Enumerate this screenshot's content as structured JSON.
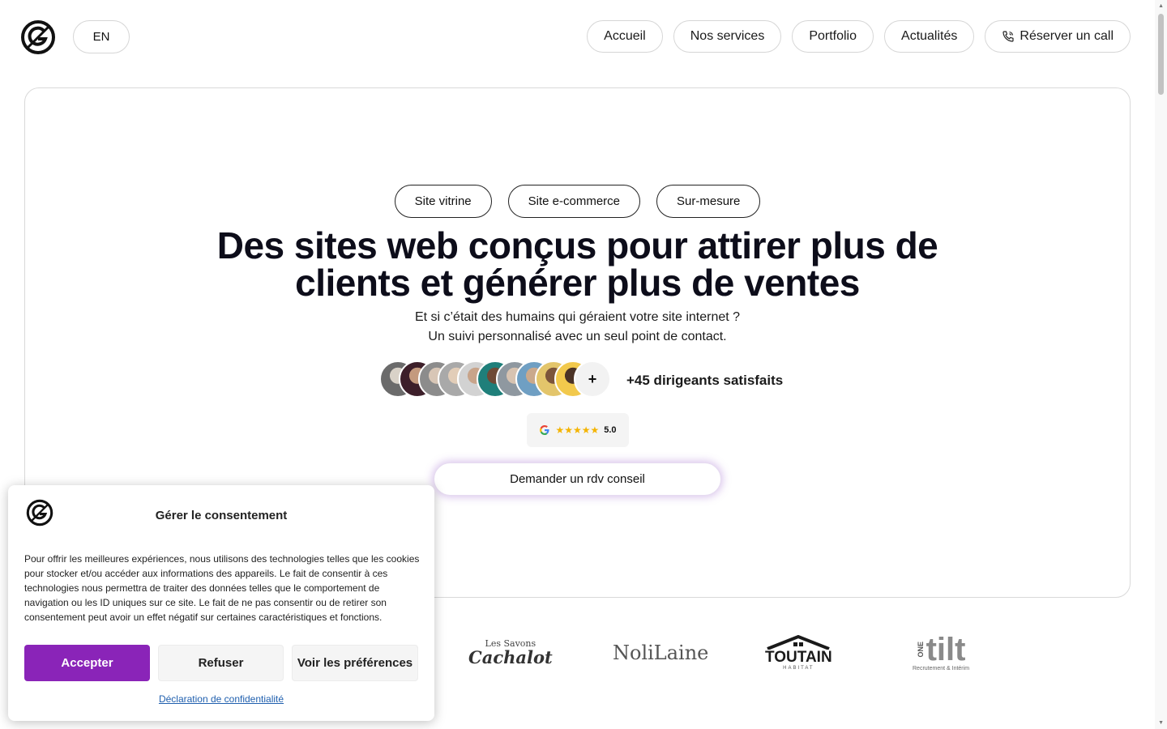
{
  "header": {
    "lang": "EN",
    "nav": [
      "Accueil",
      "Nos services",
      "Portfolio",
      "Actualités"
    ],
    "call_button": "Réserver un call"
  },
  "hero": {
    "tags": [
      "Site vitrine",
      "Site e-commerce",
      "Sur-mesure"
    ],
    "title_line1": "Des sites web conçus pour attirer plus de",
    "title_line2": "clients et générer plus de ventes",
    "subtitle_line1": "Et si c’était des humains qui géraient votre site internet ?",
    "subtitle_line2": "Un suivi personnalisé avec un seul point de contact.",
    "avatar_more": "+",
    "satisfied": "+45 dirigeants satisfaits",
    "rating_stars": "★★★★★",
    "rating_value": "5.0",
    "cta": "Demander un rdv conseil"
  },
  "clients": {
    "cachalot_small": "Les Savons",
    "cachalot_big": "Cachalot",
    "nolilaine": "NoliLaine",
    "toutain": "TOUTAIN",
    "toutain_small": "HABITAT",
    "onetilt_one": "ONE",
    "onetilt_tilt": "tilt",
    "onetilt_small": "Recrutement & Intérim"
  },
  "consent": {
    "title": "Gérer le consentement",
    "text": "Pour offrir les meilleures expériences, nous utilisons des technologies telles que les cookies pour stocker et/ou accéder aux informations des appareils. Le fait de consentir à ces technologies nous permettra de traiter des données telles que le comportement de navigation ou les ID uniques sur ce site. Le fait de ne pas consentir ou de retirer son consentement peut avoir un effet négatif sur certaines caractéristiques et fonctions.",
    "accept": "Accepter",
    "refuse": "Refuser",
    "preferences": "Voir les préférences",
    "privacy_link": "Déclaration de confidentialité"
  },
  "colors": {
    "accent": "#8a24b8",
    "cta_glow": "#965ac8",
    "rating_star": "#f4b400",
    "link": "#1f5fae"
  },
  "icons": [
    "brand-logo-icon",
    "phone-icon",
    "google-icon",
    "scroll-up-icon",
    "scroll-down-icon"
  ]
}
